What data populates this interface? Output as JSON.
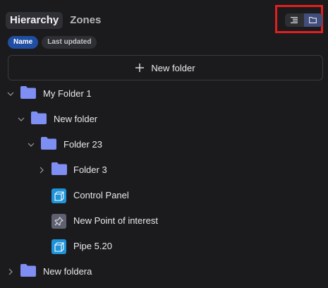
{
  "tabs": [
    {
      "label": "Hierarchy",
      "active": true
    },
    {
      "label": "Zones",
      "active": false
    }
  ],
  "view_toggle": {
    "options": [
      {
        "icon": "list-icon",
        "active": false
      },
      {
        "icon": "folder-icon",
        "active": true
      }
    ],
    "highlight_color": "#e0201f"
  },
  "sort": {
    "options": [
      {
        "label": "Name",
        "active": true
      },
      {
        "label": "Last updated",
        "active": false
      }
    ]
  },
  "new_folder_button": {
    "icon": "plus-icon",
    "label": "New folder"
  },
  "tree": [
    {
      "label": "My Folder 1",
      "type": "folder",
      "expanded": true,
      "depth": 0
    },
    {
      "label": "New folder",
      "type": "folder",
      "expanded": true,
      "depth": 1
    },
    {
      "label": "Folder 23",
      "type": "folder",
      "expanded": true,
      "depth": 2
    },
    {
      "label": "Folder 3",
      "type": "folder",
      "expanded": false,
      "depth": 3
    },
    {
      "label": "Control Panel",
      "type": "cube",
      "icon": "cube-icon",
      "depth": 3
    },
    {
      "label": "New Point of interest",
      "type": "pin",
      "icon": "pin-icon",
      "depth": 3
    },
    {
      "label": "Pipe 5.20",
      "type": "cube",
      "icon": "cube-icon",
      "depth": 3
    },
    {
      "label": "New foldera",
      "type": "folder",
      "expanded": false,
      "depth": 0
    }
  ],
  "colors": {
    "background": "#1b1b1d",
    "folder": "#7f8ef2",
    "accent": "#1f4ea3",
    "cube_icon_bg": "#1f93d8",
    "pin_icon_bg": "#5f6170"
  }
}
